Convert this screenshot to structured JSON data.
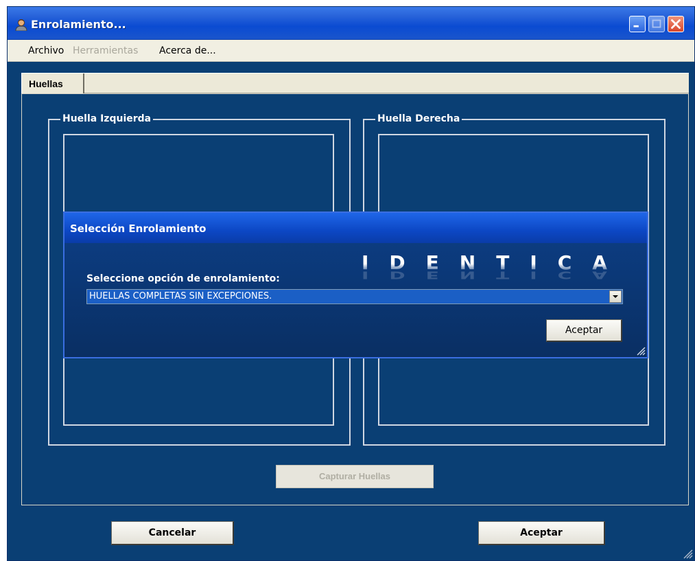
{
  "window": {
    "title": "Enrolamiento...",
    "title_icon": "user-icon",
    "buttons": [
      "minimize-icon",
      "maximize-icon",
      "close-icon"
    ]
  },
  "menu": {
    "items": [
      {
        "label": "Archivo",
        "enabled": true
      },
      {
        "label": "Herramientas",
        "enabled": false
      },
      {
        "label": "Acerca de...",
        "enabled": true
      }
    ]
  },
  "tabs": [
    {
      "label": "Huellas",
      "selected": true
    }
  ],
  "groups": {
    "left": {
      "label": "Huella Izquierda"
    },
    "right": {
      "label": "Huella Derecha"
    }
  },
  "capture_button": {
    "label": "Capturar Huellas",
    "enabled": false
  },
  "footer": {
    "cancel_label": "Cancelar",
    "accept_label": "Aceptar"
  },
  "dialog": {
    "title": "Selección Enrolamiento",
    "logo_text": "IDENTICA",
    "prompt": "Seleccione opción de enrolamiento:",
    "selected_option": "HUELLAS COMPLETAS SIN EXCEPCIONES.",
    "accept_label": "Aceptar"
  },
  "colors": {
    "background": "#0a3f74",
    "titlebar": "#0a4bd2",
    "menubar": "#f1efe2",
    "dialog_title": "#1f66e8"
  }
}
